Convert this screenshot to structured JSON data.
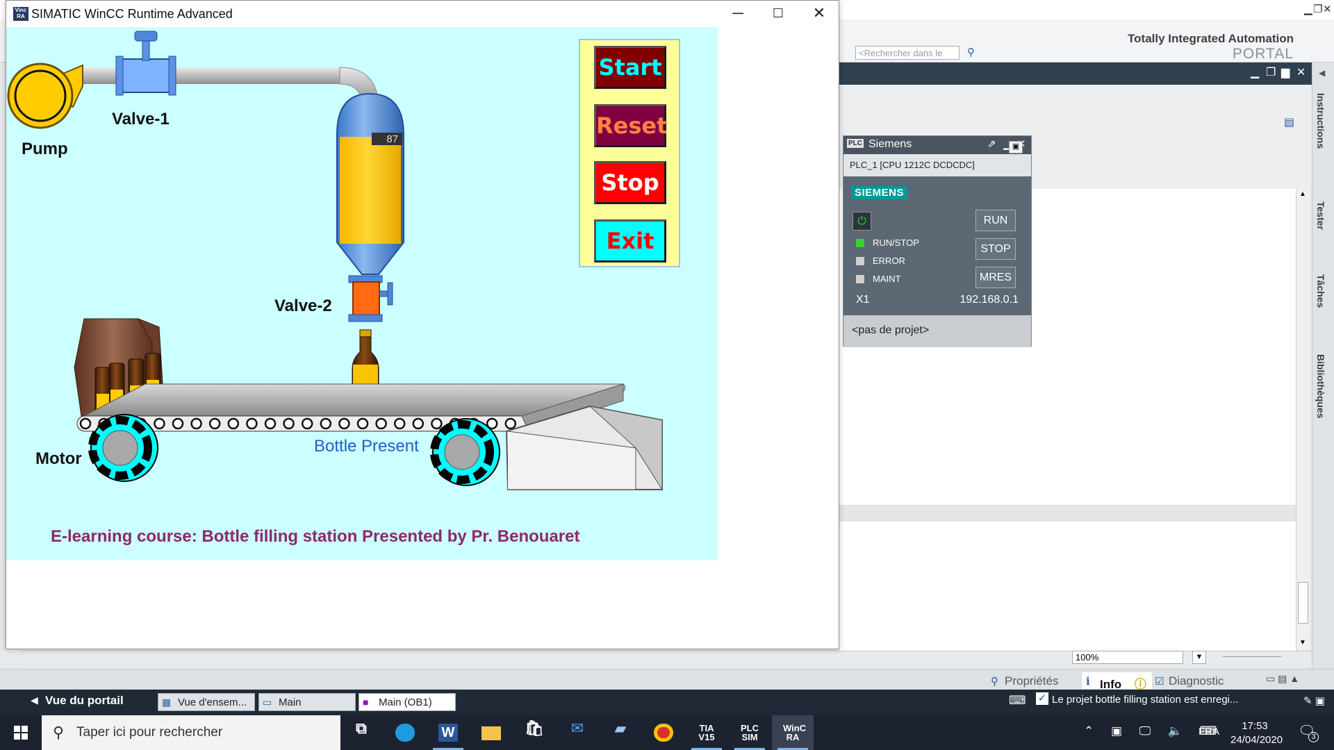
{
  "wincc_window": {
    "title": "SIMATIC WinCC Runtime Advanced",
    "icon_text": "WinCC RA"
  },
  "hmi": {
    "labels": {
      "pump": "Pump",
      "valve1": "Valve-1",
      "valve2": "Valve-2",
      "motor": "Motor",
      "bottle_present": "Bottle Present"
    },
    "tank_level": "87",
    "tank_level_fraction": 0.87,
    "footer": "E-learning course: Bottle filling station Presented by Pr. Benouaret",
    "buttons": {
      "start": "Start",
      "reset": "Reset",
      "stop": "Stop",
      "exit": "Exit"
    },
    "colors": {
      "background": "#ccffff",
      "panel": "#ffff99",
      "start_bg": "#800000",
      "start_fg": "#00ffff",
      "reset_bg": "#800040",
      "reset_fg": "#ff8040",
      "stop_bg": "#ff0000",
      "stop_fg": "#ffffff",
      "exit_bg": "#00ffff",
      "exit_fg": "#ff0000",
      "fluid": "#ffcc00"
    }
  },
  "tia": {
    "brand_line1": "Totally Integrated Automation",
    "brand_line2": "PORTAL",
    "search_placeholder": "<Rechercher dans le",
    "zoom": "100%",
    "side_tabs": [
      "Instructions",
      "Tester",
      "Tâches",
      "Bibliothèques"
    ],
    "prop_tabs": {
      "properties": "Propriétés",
      "info": "Info",
      "diagnostic": "Diagnostic"
    },
    "portal_view": "Vue du portail",
    "editor_tabs": [
      "Vue d'ensem...",
      "Main",
      "Main (OB1)"
    ],
    "status_message": "Le projet bottle filling station est enregi..."
  },
  "plcsim": {
    "title": "Siemens",
    "device": "PLC_1 [CPU 1212C DCDCDC]",
    "logo": "SIEMENS",
    "leds": [
      {
        "label": "RUN/STOP",
        "color": "#39d32f"
      },
      {
        "label": "ERROR",
        "color": "#d0d0d0"
      },
      {
        "label": "MAINT",
        "color": "#d0d0d0"
      }
    ],
    "buttons": {
      "run": "RUN",
      "stop": "STOP",
      "mres": "MRES"
    },
    "interface": "X1",
    "ip": "192.168.0.1",
    "project": "<pas de projet>"
  },
  "taskbar": {
    "search_placeholder": "Taper ici pour rechercher",
    "apps": [
      {
        "name": "task-view",
        "label": ""
      },
      {
        "name": "edge",
        "label": ""
      },
      {
        "name": "word",
        "label": "W"
      },
      {
        "name": "explorer",
        "label": ""
      },
      {
        "name": "store",
        "label": ""
      },
      {
        "name": "mail",
        "label": ""
      },
      {
        "name": "plc-app",
        "label": ""
      },
      {
        "name": "chrome",
        "label": ""
      },
      {
        "name": "tia",
        "label": "TIA V15"
      },
      {
        "name": "plcsim",
        "label": "PLC SIM"
      },
      {
        "name": "wincc",
        "label": "WinC RA"
      }
    ],
    "language": "FRA",
    "time": "17:53",
    "date": "24/04/2020",
    "notifications": "3"
  }
}
